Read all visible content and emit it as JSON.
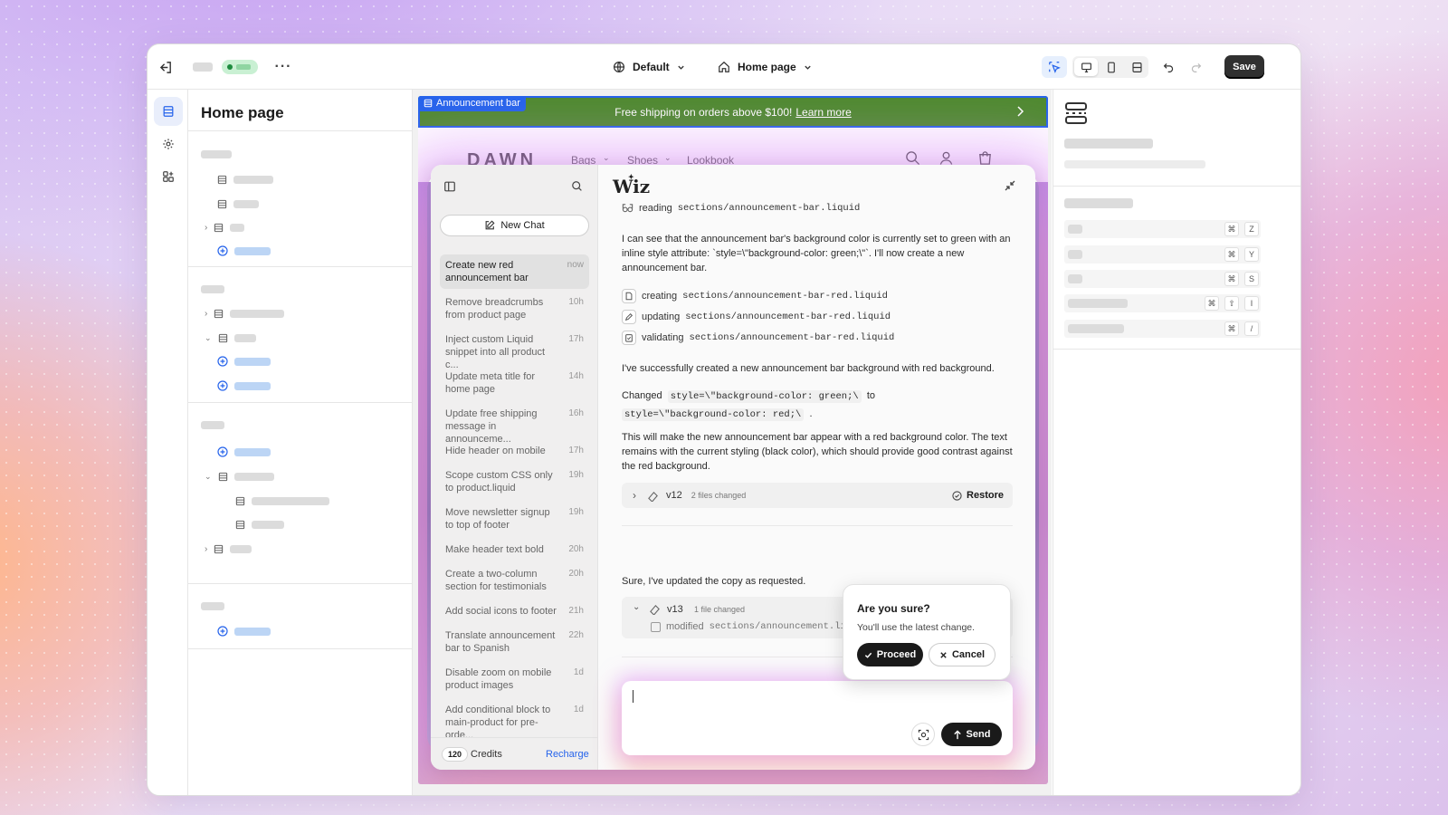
{
  "topbar": {
    "theme_label": "Default",
    "page_label": "Home page",
    "save_label": "Save"
  },
  "left_panel": {
    "title": "Home page"
  },
  "storefront": {
    "tag_label": "Announcement bar",
    "announcement_text": "Free shipping on orders above $100!",
    "announcement_link": "Learn more",
    "logo": "DAWN",
    "nav": [
      "Bags",
      "Shoes",
      "Lookbook"
    ]
  },
  "assistant": {
    "logo": "Wiz",
    "new_chat_label": "New Chat",
    "history": [
      {
        "title": "Create new red announcement bar",
        "time": "now"
      },
      {
        "title": "Remove breadcrumbs from product page",
        "time": "10h"
      },
      {
        "title": "Inject custom Liquid snippet into all product c...",
        "time": "17h"
      },
      {
        "title": "Update meta title for home page",
        "time": "14h"
      },
      {
        "title": "Update free shipping message in announceme...",
        "time": "16h"
      },
      {
        "title": "Hide header on mobile",
        "time": "17h"
      },
      {
        "title": "Scope custom CSS only to product.liquid",
        "time": "19h"
      },
      {
        "title": "Move newsletter signup to top of footer",
        "time": "19h"
      },
      {
        "title": "Make header text bold",
        "time": "20h"
      },
      {
        "title": "Create a two-column section for testimonials",
        "time": "20h"
      },
      {
        "title": "Add social icons to footer",
        "time": "21h"
      },
      {
        "title": "Translate announcement bar to Spanish",
        "time": "22h"
      },
      {
        "title": "Disable zoom on mobile product images",
        "time": "1d"
      },
      {
        "title": "Add conditional block to main-product for pre-orde...",
        "time": "1d"
      }
    ],
    "credits_count": "120",
    "credits_label": "Credits",
    "recharge_label": "Recharge",
    "reading_verb": "reading",
    "reading_file": "sections/announcement-bar.liquid",
    "msg1": "I can see that the announcement bar's background color is currently set to green with an inline style attribute: `style=\\\"background-color: green;\\\"`. I'll now create a new announcement bar.",
    "actions": [
      {
        "verb": "creating",
        "file": "sections/announcement-bar-red.liquid"
      },
      {
        "verb": "updating",
        "file": "sections/announcement-bar-red.liquid"
      },
      {
        "verb": "validating",
        "file": "sections/announcement-bar-red.liquid"
      }
    ],
    "msg2": "I've successfully created a new announcement bar background with red background.",
    "changed_label": "Changed",
    "changed_from": "style=\\\"background-color: green;\\",
    "to_label": "to",
    "changed_to": "style=\\\"background-color: red;\\",
    "changed_end": ".",
    "msg3": "This will make the new announcement bar appear with a red background color. The text remains with the current styling (black color), which should provide good contrast against the red background.",
    "v12": {
      "label": "v12",
      "info": "2 files changed",
      "restore": "Restore"
    },
    "msg4": "Sure, I've updated the copy as requested.",
    "v13": {
      "label": "v13",
      "info": "1 file changed",
      "modified_verb": "modified",
      "modified_file": "sections/announcement.liq"
    },
    "send_label": "Send"
  },
  "confirm": {
    "title": "Are you sure?",
    "body": "You'll use the latest change.",
    "proceed": "Proceed",
    "cancel": "Cancel"
  },
  "shortcuts": [
    {
      "keys": [
        "⌘",
        "Z"
      ]
    },
    {
      "keys": [
        "⌘",
        "Y"
      ]
    },
    {
      "keys": [
        "⌘",
        "S"
      ]
    },
    {
      "keys": [
        "⌘",
        "⇧",
        "I"
      ]
    },
    {
      "keys": [
        "⌘",
        "/"
      ]
    }
  ],
  "colors": {
    "accent_blue": "#2563eb",
    "announcement_green": "#4f8a2f",
    "save_button": "#303030"
  }
}
